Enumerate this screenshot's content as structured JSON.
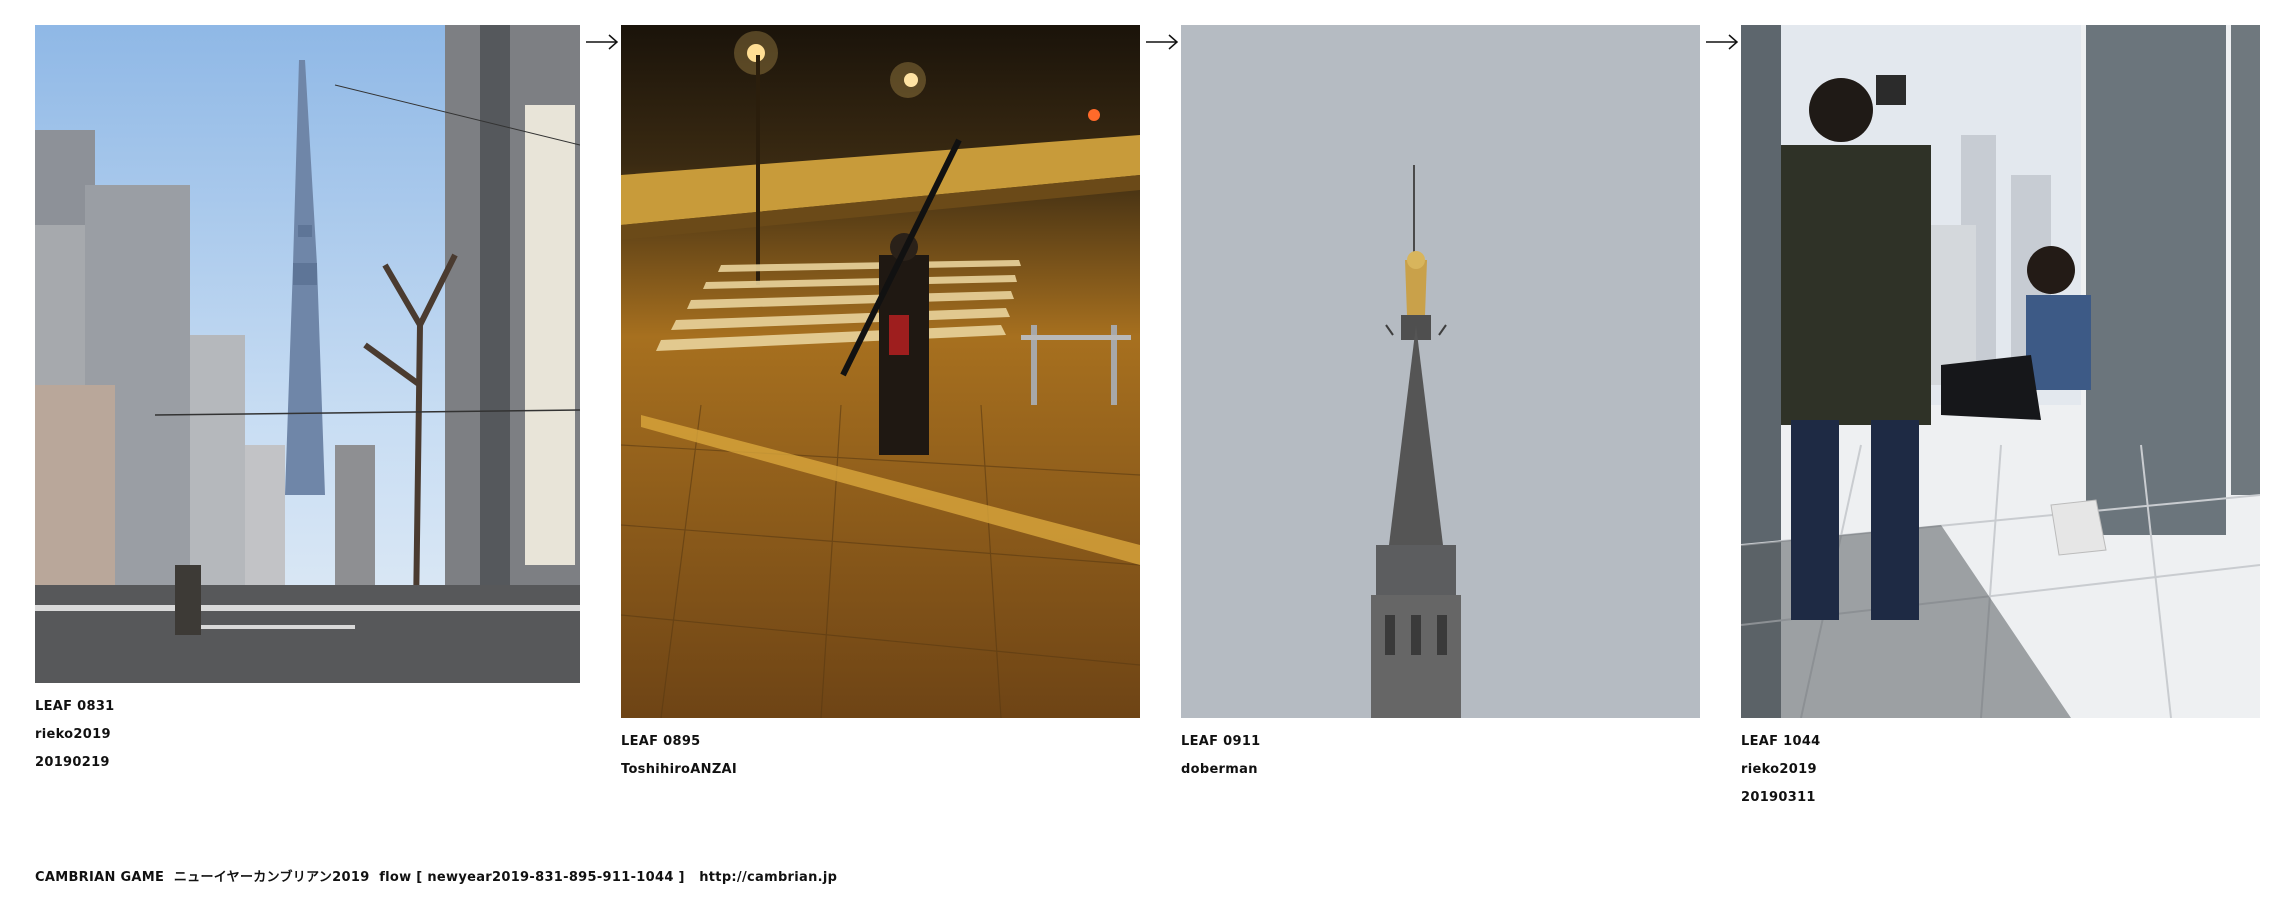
{
  "flow": {
    "items": [
      {
        "leaf": "LEAF 0831",
        "author": "rieko2019",
        "date": "20190219",
        "image_icon": "tokyo-skytree-street-photo"
      },
      {
        "leaf": "LEAF 0895",
        "author": "ToshihiroANZAI",
        "date": "",
        "image_icon": "night-crossing-photo"
      },
      {
        "leaf": "LEAF 0911",
        "author": "doberman",
        "date": "",
        "image_icon": "church-spire-photo"
      },
      {
        "leaf": "LEAF 1044",
        "author": "rieko2019",
        "date": "20190311",
        "image_icon": "observation-deck-photo"
      }
    ],
    "arrow_icon": "right-arrow-icon"
  },
  "footer": {
    "title": "CAMBRIAN GAME",
    "subtitle": "ニューイヤーカンブリアン2019",
    "flow_label": "flow [ newyear2019-831-895-911-1044 ]",
    "url": "http://cambrian.jp"
  },
  "colors": {
    "sky": "#a9c9ec",
    "night": "#2a1d0c",
    "amber": "#c8892a",
    "overcast": "#b6bcc3",
    "deck_floor": "#e7e9eb",
    "text": "#111111"
  }
}
